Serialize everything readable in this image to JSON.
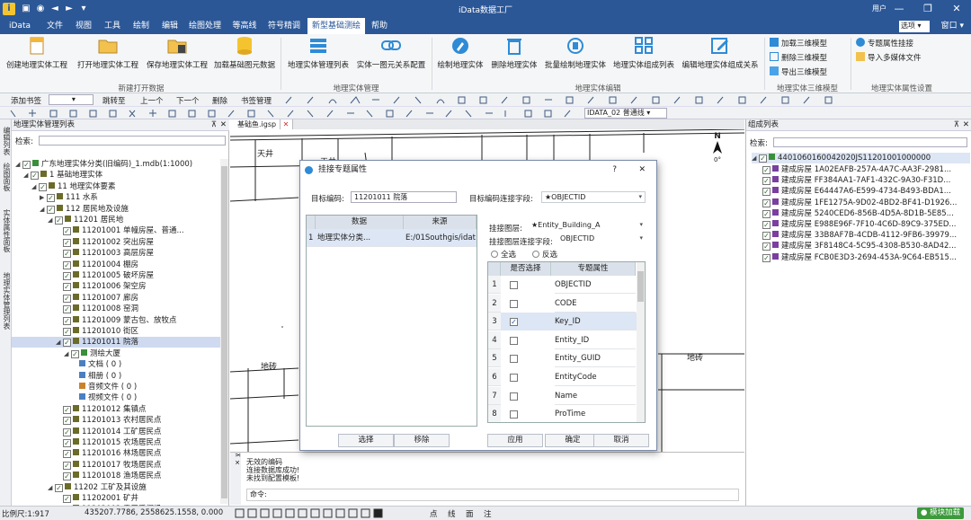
{
  "app": {
    "title": "iData数据工厂",
    "user": "用户"
  },
  "menu": {
    "items": [
      "iData",
      "文件",
      "视图",
      "工具",
      "绘制",
      "编辑",
      "绘图处理",
      "等高线",
      "符号精调",
      "新型基础测绘",
      "帮助"
    ],
    "active_index": 9,
    "style_select": "选项",
    "window": "窗口"
  },
  "ribbon": {
    "buttons": [
      "创建地理实体工程",
      "打开地理实体工程",
      "保存地理实体工程",
      "加载基础图元数据",
      "地理实体管理列表",
      "实体一图元关系配置",
      "绘制地理实体",
      "删除地理实体",
      "批量绘制地理实体",
      "地理实体组成列表",
      "编辑地理实体组成关系"
    ],
    "small_3d": [
      "加载三维模型",
      "删除三维模型",
      "导出三维模型"
    ],
    "small_attr": [
      "专题属性挂接",
      "导入多媒体文件"
    ],
    "groups": [
      "新建打开数据",
      "地理实体管理",
      "地理实体编辑",
      "地理实体三维模型",
      "地理实体属性设置"
    ]
  },
  "toolbar": {
    "add_bookmark": "添加书签",
    "jump_to": "跳转至",
    "prev": "上一个",
    "next": "下一个",
    "delete": "删除",
    "bookmark_mgr": "书签管理",
    "layer_select": "IDATA_02 普通线"
  },
  "left_panel": {
    "title": "地理实体管理列表",
    "search_label": "检索:",
    "vtabs": [
      "编辑列表",
      "绘图面板",
      "实体属性面板",
      "地理实体管理列表"
    ],
    "tree": [
      {
        "level": 0,
        "expand": "◢",
        "check": true,
        "icon": "#3a8f3a",
        "label": "广东地理实体分类(旧编码)_1.mdb(1:1000)"
      },
      {
        "level": 1,
        "expand": "◢",
        "check": true,
        "icon": "#6b6b2a",
        "label": "1 基础地理实体"
      },
      {
        "level": 2,
        "expand": "◢",
        "check": true,
        "icon": "#6b6b2a",
        "label": "11 地理实体要素"
      },
      {
        "level": 3,
        "expand": "▶",
        "check": true,
        "icon": "#6b6b2a",
        "label": "111 水系"
      },
      {
        "level": 3,
        "expand": "◢",
        "check": true,
        "icon": "#6b6b2a",
        "label": "112 居民地及设施"
      },
      {
        "level": 4,
        "expand": "◢",
        "check": true,
        "icon": "#6b6b2a",
        "label": "11201 居民地"
      },
      {
        "level": 5,
        "expand": "",
        "check": true,
        "icon": "#6b6b2a",
        "label": "11201001 单幢房屋、普通..."
      },
      {
        "level": 5,
        "expand": "",
        "check": true,
        "icon": "#6b6b2a",
        "label": "11201002 突出房屋"
      },
      {
        "level": 5,
        "expand": "",
        "check": true,
        "icon": "#6b6b2a",
        "label": "11201003 高层房屋"
      },
      {
        "level": 5,
        "expand": "",
        "check": true,
        "icon": "#6b6b2a",
        "label": "11201004 棚房"
      },
      {
        "level": 5,
        "expand": "",
        "check": true,
        "icon": "#6b6b2a",
        "label": "11201005 破坏房屋"
      },
      {
        "level": 5,
        "expand": "",
        "check": true,
        "icon": "#6b6b2a",
        "label": "11201006 架空房"
      },
      {
        "level": 5,
        "expand": "",
        "check": true,
        "icon": "#6b6b2a",
        "label": "11201007 廊房"
      },
      {
        "level": 5,
        "expand": "",
        "check": true,
        "icon": "#6b6b2a",
        "label": "11201008 窑洞"
      },
      {
        "level": 5,
        "expand": "",
        "check": true,
        "icon": "#6b6b2a",
        "label": "11201009 蒙古包、放牧点"
      },
      {
        "level": 5,
        "expand": "",
        "check": true,
        "icon": "#6b6b2a",
        "label": "11201010 街区"
      },
      {
        "level": 5,
        "expand": "◢",
        "check": true,
        "icon": "#6b6b2a",
        "label": "11201011 院落",
        "selected": true
      },
      {
        "level": 6,
        "expand": "◢",
        "check": true,
        "icon": "#3a8f3a",
        "label": "测绘大厦"
      },
      {
        "level": 7,
        "expand": "",
        "check": null,
        "icon": "#4a7fc1",
        "label": "文档 ( 0 )"
      },
      {
        "level": 7,
        "expand": "",
        "check": null,
        "icon": "#4a7fc1",
        "label": "相册 ( 0 )"
      },
      {
        "level": 7,
        "expand": "",
        "check": null,
        "icon": "#c9822a",
        "label": "音频文件 ( 0 )"
      },
      {
        "level": 7,
        "expand": "",
        "check": null,
        "icon": "#4a7fc1",
        "label": "视频文件 ( 0 )"
      },
      {
        "level": 5,
        "expand": "",
        "check": true,
        "icon": "#6b6b2a",
        "label": "11201012 集镇点"
      },
      {
        "level": 5,
        "expand": "",
        "check": true,
        "icon": "#6b6b2a",
        "label": "11201013 农村居民点"
      },
      {
        "level": 5,
        "expand": "",
        "check": true,
        "icon": "#6b6b2a",
        "label": "11201014 工矿居民点"
      },
      {
        "level": 5,
        "expand": "",
        "check": true,
        "icon": "#6b6b2a",
        "label": "11201015 农场居民点"
      },
      {
        "level": 5,
        "expand": "",
        "check": true,
        "icon": "#6b6b2a",
        "label": "11201016 林场居民点"
      },
      {
        "level": 5,
        "expand": "",
        "check": true,
        "icon": "#6b6b2a",
        "label": "11201017 牧场居民点"
      },
      {
        "level": 5,
        "expand": "",
        "check": true,
        "icon": "#6b6b2a",
        "label": "11201018 渔场居民点"
      },
      {
        "level": 4,
        "expand": "◢",
        "check": true,
        "icon": "#6b6b2a",
        "label": "11202 工矿及其设施"
      },
      {
        "level": 5,
        "expand": "",
        "check": true,
        "icon": "#6b6b2a",
        "label": "11202001 矿井"
      },
      {
        "level": 5,
        "expand": "",
        "check": true,
        "icon": "#6b6b2a",
        "label": "11202002 露天采掘场"
      }
    ]
  },
  "map": {
    "tab": "基础鱼.igsp",
    "labels": {
      "a": "天井",
      "b": "天井",
      "c": "地砖",
      "d": "地砖"
    },
    "north": {
      "letter": "N",
      "deg": "0°"
    }
  },
  "log": {
    "lines": [
      "无效的编码",
      "连接数据库成功!",
      "未找到配置模板!"
    ],
    "cmd_label": "命令:"
  },
  "right_panel": {
    "title": "组成列表",
    "search_label": "检索:",
    "root": "4401060160042020JS11201001000000",
    "items": [
      {
        "type": "建成房屋",
        "id": "1A02EAFB-257A-4A7C-AA3F-2981..."
      },
      {
        "type": "建成房屋",
        "id": "FF384AA1-7AF1-432C-9A30-F31D..."
      },
      {
        "type": "建成房屋",
        "id": "E64447A6-E599-4734-B493-BDA1..."
      },
      {
        "type": "建成房屋",
        "id": "1FE1275A-9D02-4BD2-BF41-D1926..."
      },
      {
        "type": "建成房屋",
        "id": "5240CED6-856B-4D5A-8D1B-5E85..."
      },
      {
        "type": "建成房屋",
        "id": "E988E96F-7F10-4C6D-89C9-375ED..."
      },
      {
        "type": "建成房屋",
        "id": "33B8AF7B-4CDB-4112-9FB6-39979..."
      },
      {
        "type": "建成房屋",
        "id": "3F8148C4-5C95-4308-B530-8AD42..."
      },
      {
        "type": "建成房屋",
        "id": "FCB0E3D3-2694-453A-9C64-EB515..."
      }
    ]
  },
  "dialog": {
    "title": "挂接专题属性",
    "help": "?",
    "close": "✕",
    "target_code_label": "目标编码:",
    "target_code_value": "11201011 院落",
    "target_link_label": "目标编码连接字段:",
    "target_link_value": "★OBJECTID",
    "left_grid": {
      "headers": [
        "数据",
        "来源"
      ],
      "rows": [
        {
          "no": "1",
          "data": "地理实体分类...",
          "source": "E:/01Southgis/idat..."
        }
      ]
    },
    "hang_layer_label": "挂接图层:",
    "hang_layer_value": "★Entity_Building_A",
    "hang_field_label": "挂接图层连接字段:",
    "hang_field_value": "OBJECTID",
    "select_all": "全选",
    "invert": "反选",
    "right_grid": {
      "headers": [
        "是否选择",
        "专题属性"
      ],
      "rows": [
        {
          "no": "1",
          "checked": false,
          "attr": "OBJECTID"
        },
        {
          "no": "2",
          "checked": false,
          "attr": "CODE"
        },
        {
          "no": "3",
          "checked": true,
          "attr": "Key_ID"
        },
        {
          "no": "4",
          "checked": false,
          "attr": "Entity_ID"
        },
        {
          "no": "5",
          "checked": false,
          "attr": "Entity_GUID"
        },
        {
          "no": "6",
          "checked": false,
          "attr": "EntityCode"
        },
        {
          "no": "7",
          "checked": false,
          "attr": "Name"
        },
        {
          "no": "8",
          "checked": false,
          "attr": "ProTime"
        }
      ]
    },
    "buttons": {
      "select": "选择",
      "remove": "移除",
      "apply": "应用",
      "ok": "确定",
      "cancel": "取消"
    }
  },
  "status": {
    "scale": "比例尺:1:917",
    "coords": "435207.7786, 2558625.1558, 0.000",
    "snap": [
      "点",
      "线",
      "面",
      "注"
    ],
    "model": "模块加载"
  }
}
